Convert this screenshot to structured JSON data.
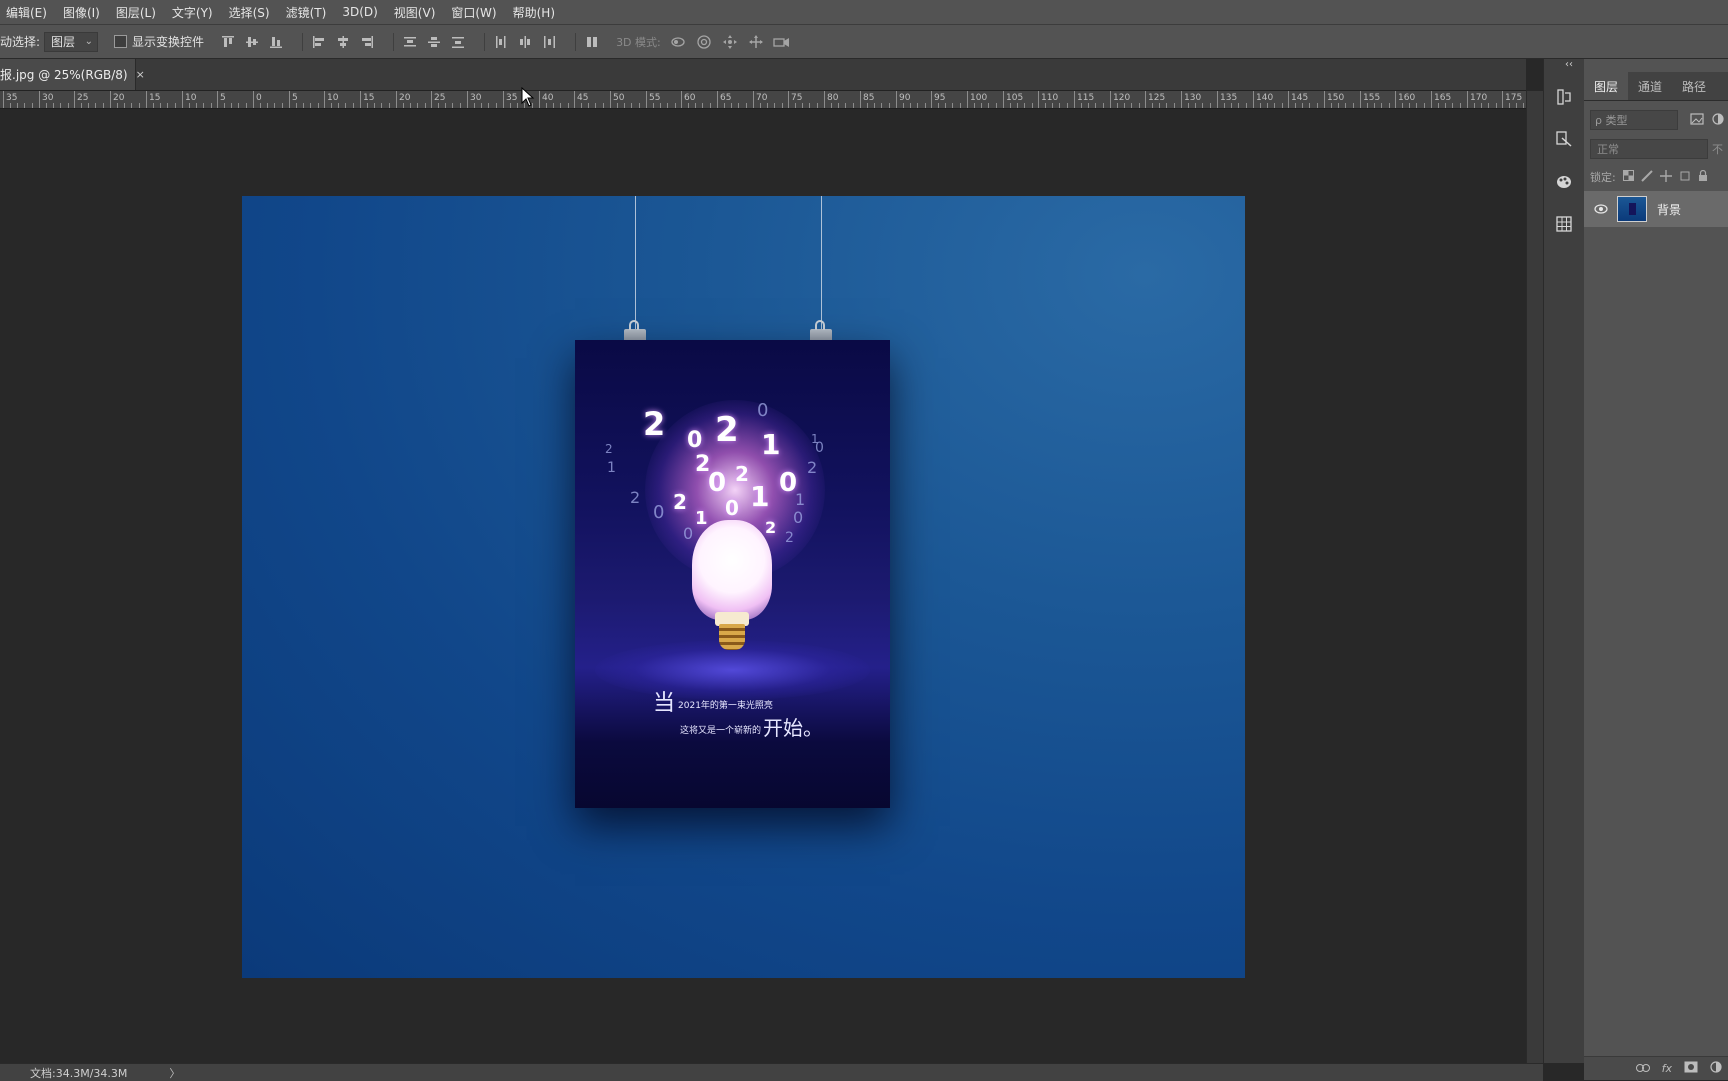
{
  "menu": [
    "编辑(E)",
    "图像(I)",
    "图层(L)",
    "文字(Y)",
    "选择(S)",
    "滤镜(T)",
    "3D(D)",
    "视图(V)",
    "窗口(W)",
    "帮助(H)"
  ],
  "options": {
    "auto_select_label": "动选择:",
    "auto_select_value": "图层",
    "transform_controls_label": "显示变换控件",
    "mode_3d_label": "3D 模式:"
  },
  "document_tab": {
    "title": "报.jpg @ 25%(RGB/8)",
    "close": "×"
  },
  "ruler_labels": [
    "35",
    "30",
    "25",
    "20",
    "15",
    "10",
    "5",
    "0",
    "5",
    "10",
    "15",
    "20",
    "25",
    "30",
    "35",
    "40",
    "45",
    "50",
    "55",
    "60",
    "65",
    "70",
    "75",
    "80",
    "85",
    "90",
    "95",
    "100",
    "105",
    "110",
    "115",
    "120",
    "125",
    "130",
    "135",
    "140",
    "145",
    "150",
    "155",
    "160",
    "165",
    "170",
    "175"
  ],
  "poster": {
    "numerals": [
      "2",
      "0",
      "2",
      "1",
      "0",
      "2",
      "0",
      "2",
      "1",
      "0",
      "2",
      "0",
      "2",
      "1",
      "2",
      "0",
      "2",
      "1",
      "0",
      "1",
      "1",
      "2",
      "0",
      "2",
      "0"
    ],
    "line1_big": "当",
    "line1_text": "2021年的第一束光照亮",
    "line2_text": "这将又是一个崭新的",
    "line2_big": "开始。"
  },
  "panel": {
    "tabs": [
      "图层",
      "通道",
      "路径"
    ],
    "filter_placeholder": "ρ 类型",
    "blend_mode": "正常",
    "opacity_label": "不",
    "lock_label": "锁定:",
    "layer_name": "背景"
  },
  "status": {
    "doc_size": "文档:34.3M/34.3M",
    "arrow": "〉"
  },
  "colors": {
    "canvas_background": "#1b5795",
    "poster_background": "#12125e",
    "ui_dark": "#282828",
    "ui_panel": "#535353"
  }
}
